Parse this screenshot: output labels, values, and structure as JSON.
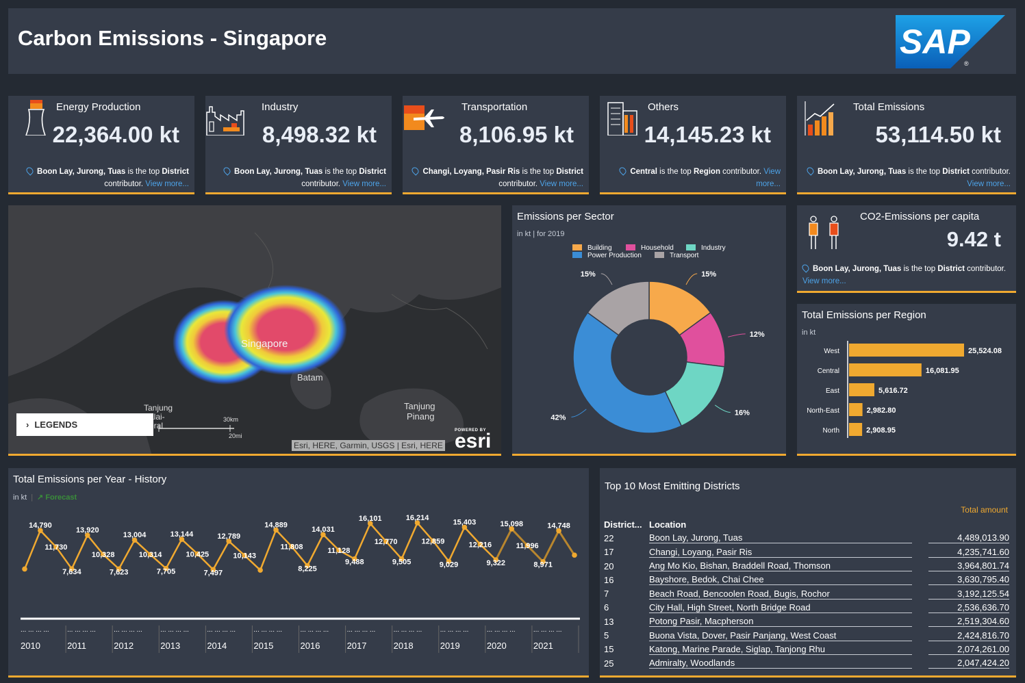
{
  "header": {
    "title": "Carbon Emissions - Singapore",
    "logo_text": "SAP"
  },
  "colors": {
    "accent": "#f0a930",
    "link": "#4da3e8",
    "building": "#f7a94b",
    "household": "#e0509d",
    "industry": "#6ed6c4",
    "power": "#3b8dd6",
    "transport": "#a9a3a5"
  },
  "kpis": [
    {
      "icon": "power-plant-icon",
      "title": "Energy Production",
      "value": "22,364.00 kt",
      "bold": "Boon Lay, Jurong, Tuas",
      "mid": " is the top ",
      "level": "District",
      "end": " contributor. ",
      "link": "View more..."
    },
    {
      "icon": "factory-icon",
      "title": "Industry",
      "value": "8,498.32 kt",
      "bold": "Boon Lay, Jurong, Tuas",
      "mid": " is the top ",
      "level": "District",
      "end": " contributor. ",
      "link": "View more..."
    },
    {
      "icon": "airplane-icon",
      "title": "Transportation",
      "value": "8,106.95 kt",
      "bold": "Changi, Loyang, Pasir Ris",
      "mid": " is the top ",
      "level": "District",
      "end": " contributor. ",
      "link": "View more..."
    },
    {
      "icon": "building-icon",
      "title": "Others",
      "value": "14,145.23 kt",
      "bold": "Central",
      "mid": " is the top ",
      "level": "Region",
      "end": " contributor. ",
      "link": "View more..."
    },
    {
      "icon": "bar-growth-icon",
      "title": "Total Emissions",
      "value": "53,114.50 kt",
      "bold": "Boon Lay, Jurong, Tuas",
      "mid": " is the top ",
      "level": "District",
      "end": " contributor. ",
      "link": "View more..."
    }
  ],
  "map": {
    "labels": {
      "singapore": "Singapore",
      "batam": "Batam",
      "tanjung_balai": "Tanjung\nBalai-\nKeral",
      "tanjung_pinang": "Tanjung\nPinang"
    },
    "legends": "LEGENDS",
    "scale_km": "30km",
    "scale_mi": "20mi",
    "attribution": "Esri, HERE, Garmin, USGS | Esri, HERE",
    "powered": "POWERED BY",
    "esri": "esri"
  },
  "sector": {
    "title": "Emissions per Sector",
    "subtitle": "in kt | for 2019"
  },
  "capita": {
    "title": "CO2-Emissions per capita",
    "value": "9.42 t",
    "bold": "Boon Lay, Jurong, Tuas",
    "mid": " is the top ",
    "level": "District",
    "end": " contributor. ",
    "link": "View more..."
  },
  "region": {
    "title": "Total Emissions per Region",
    "unit": "in kt"
  },
  "history": {
    "title": "Total Emissions per Year - History",
    "unit": "in kt",
    "forecast": "Forecast",
    "ellipsis": "... ... ... ..."
  },
  "districts": {
    "title": "Top 10 Most Emitting Districts",
    "total_label": "Total amount",
    "col_district": "District...",
    "col_location": "Location",
    "rows": [
      {
        "d": "22",
        "loc": "Boon Lay, Jurong, Tuas",
        "amt": "4,489,013.90"
      },
      {
        "d": "17",
        "loc": "Changi, Loyang, Pasir Ris",
        "amt": "4,235,741.60"
      },
      {
        "d": "20",
        "loc": "Ang Mo Kio, Bishan, Braddell Road, Thomson",
        "amt": "3,964,801.74"
      },
      {
        "d": "16",
        "loc": "Bayshore, Bedok, Chai Chee",
        "amt": "3,630,795.40"
      },
      {
        "d": "7",
        "loc": "Beach Road, Bencoolen Road, Bugis, Rochor",
        "amt": "3,192,125.54"
      },
      {
        "d": "6",
        "loc": "City Hall, High Street, North Bridge Road",
        "amt": "2,536,636.70"
      },
      {
        "d": "13",
        "loc": "Potong Pasir, Macpherson",
        "amt": "2,519,304.60"
      },
      {
        "d": "5",
        "loc": "Buona Vista, Dover, Pasir Panjang, West Coast",
        "amt": "2,424,816.70"
      },
      {
        "d": "15",
        "loc": "Katong, Marine Parade, Siglap, Tanjong Rhu",
        "amt": "2,074,261.00"
      },
      {
        "d": "25",
        "loc": "Admiralty, Woodlands",
        "amt": "2,047,424.20"
      }
    ]
  },
  "chart_data": [
    {
      "type": "pie",
      "title": "Emissions per Sector",
      "subtitle": "in kt | for 2019",
      "legend": [
        "Building",
        "Household",
        "Industry",
        "Power Production",
        "Transport"
      ],
      "slices": [
        {
          "name": "Building",
          "value": 15,
          "label": "15%"
        },
        {
          "name": "Household",
          "value": 12,
          "label": "12%"
        },
        {
          "name": "Industry",
          "value": 16,
          "label": "16%"
        },
        {
          "name": "Power Production",
          "value": 42,
          "label": "42%"
        },
        {
          "name": "Transport",
          "value": 15,
          "label": "15%"
        }
      ]
    },
    {
      "type": "bar",
      "title": "Total Emissions per Region",
      "ylabel": "in kt",
      "categories": [
        "West",
        "Central",
        "East",
        "North-East",
        "North"
      ],
      "values": [
        25524.08,
        16081.95,
        5616.72,
        2982.8,
        2908.95
      ],
      "labels": [
        "25,524.08",
        "16,081.95",
        "5,616.72",
        "2,982.80",
        "2,908.95"
      ]
    },
    {
      "type": "line",
      "title": "Total Emissions per Year - History",
      "ylabel": "in kt",
      "years": [
        "2010",
        "2011",
        "2012",
        "2013",
        "2014",
        "2015",
        "2016",
        "2017",
        "2018",
        "2019",
        "2020",
        "2021"
      ],
      "values": [
        7600,
        14790,
        11730,
        7634,
        13920,
        10328,
        7623,
        13004,
        10314,
        7705,
        13144,
        10425,
        7497,
        12789,
        10143,
        7400,
        14889,
        11808,
        8225,
        14031,
        11128,
        9488,
        16101,
        12770,
        9505,
        16214,
        12859,
        9029,
        15403,
        12216,
        9322,
        15098,
        11996,
        8971,
        14748,
        10200
      ],
      "labels": [
        "",
        "14,790",
        "11,730",
        "7,634",
        "13,920",
        "10,328",
        "7,623",
        "13,004",
        "10,314",
        "7,705",
        "13,144",
        "10,425",
        "7,497",
        "12,789",
        "10,143",
        "",
        "14,889",
        "11,808",
        "8,225",
        "14,031",
        "11,128",
        "9,488",
        "16,101",
        "12,770",
        "9,505",
        "16,214",
        "12,859",
        "9,029",
        "15,403",
        "12,216",
        "9,322",
        "15,098",
        "11,996",
        "8,971",
        "14,748",
        ""
      ],
      "forecast_from": 30,
      "ylim": [
        6000,
        17500
      ]
    }
  ]
}
